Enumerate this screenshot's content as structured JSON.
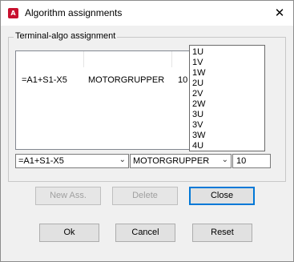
{
  "window": {
    "title": "Algorithm assignments",
    "app_icon_text": "A"
  },
  "group": {
    "label": "Terminal-algo assignment"
  },
  "list_row": {
    "terminal": "=A1+S1-X5",
    "group": "MOTORGRUPPER",
    "value": "10"
  },
  "dropdown_options": [
    "1U",
    "1V",
    "1W",
    "2U",
    "2V",
    "2W",
    "3U",
    "3V",
    "3W",
    "4U"
  ],
  "editors": {
    "terminal_combo": "=A1+S1-X5",
    "group_combo": "MOTORGRUPPER",
    "value_field": "10"
  },
  "buttons": {
    "new_ass": "New Ass.",
    "delete": "Delete",
    "close": "Close",
    "ok": "Ok",
    "cancel": "Cancel",
    "reset": "Reset"
  },
  "icons": {
    "close": "close-icon",
    "chevron": "chevron-down-icon"
  }
}
